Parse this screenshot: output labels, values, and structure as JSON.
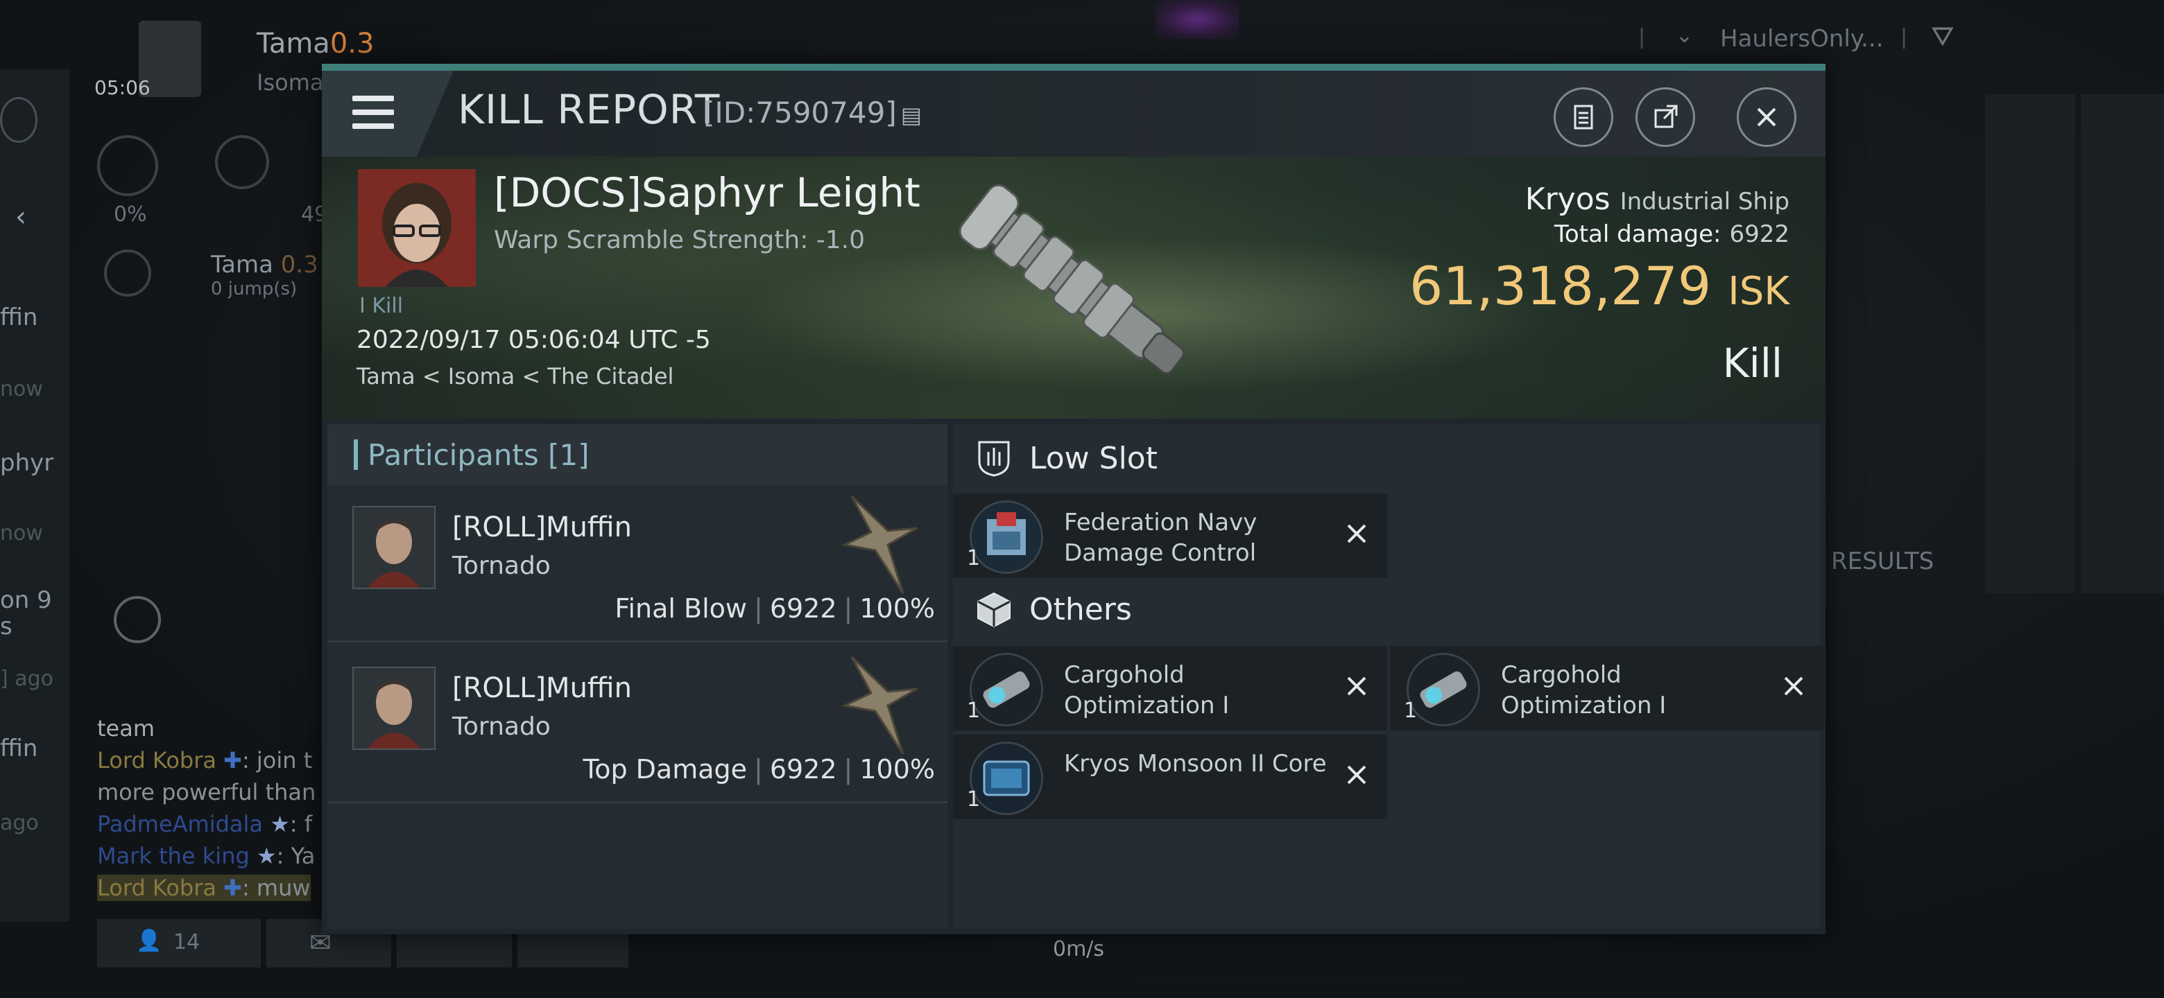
{
  "background": {
    "top_left": {
      "clock": "05:06",
      "player_name": "Tama",
      "player_sec": "0.3",
      "location_partial": "Isoma",
      "percent_a": "0%",
      "percent_b": "49",
      "route_system": "Tama",
      "route_sec": "0.3",
      "route_jumps": "0 jump(s)"
    },
    "top_right": {
      "filter_label": "HaulersOnly..."
    },
    "left_list_fragments": [
      "ffin",
      "now",
      "phyr",
      "now",
      "on 9",
      "s",
      "] ago",
      "ffin",
      "ago"
    ],
    "chat": {
      "channel": "team",
      "lines": [
        {
          "speaker": "Lord Kobra",
          "text": ": join t"
        },
        {
          "speaker": "",
          "text": "more powerful than"
        },
        {
          "speaker": "PadmeAmidala",
          "text": ": f"
        },
        {
          "speaker": "Mark the king",
          "text": ": Ya"
        },
        {
          "speaker": "Lord Kobra",
          "text": ": muw"
        }
      ]
    },
    "bottom_bar": {
      "members_count": "14",
      "speed": "0m/s"
    },
    "results_label": "RESULTS"
  },
  "window": {
    "title": "KILL REPORT",
    "id_label": "[ID:7590749]",
    "buttons": {
      "copy": "clipboard-icon",
      "share": "share-icon",
      "close": "close-icon"
    }
  },
  "banner": {
    "victim_name": "[DOCS]Saphyr Leight",
    "warp_scramble": "Warp Scramble Strength: -1.0",
    "kill_tag": "I Kill",
    "timestamp": "2022/09/17 05:06:04 UTC -5",
    "location": "Tama < Isoma < The Citadel",
    "ship_name": "Kryos",
    "ship_class": "Industrial Ship",
    "total_damage_label": "Total damage:",
    "total_damage_value": "6922",
    "isk_value": "61,318,279",
    "isk_unit": "ISK",
    "result": "Kill"
  },
  "participants": {
    "title": "Participants [1]",
    "rows": [
      {
        "name": "[ROLL]Muffin",
        "ship": "Tornado",
        "role": "Final Blow",
        "damage": "6922",
        "percent": "100%"
      },
      {
        "name": "[ROLL]Muffin",
        "ship": "Tornado",
        "role": "Top Damage",
        "damage": "6922",
        "percent": "100%"
      }
    ]
  },
  "modules": {
    "low_slot": {
      "title": "Low Slot",
      "items": [
        {
          "qty": "1",
          "name": "Federation Navy Damage Control"
        }
      ]
    },
    "others": {
      "title": "Others",
      "items": [
        {
          "qty": "1",
          "name": "Cargohold Optimization I"
        },
        {
          "qty": "1",
          "name": "Cargohold Optimization I"
        },
        {
          "qty": "1",
          "name": "Kryos Monsoon II Core"
        }
      ]
    }
  }
}
